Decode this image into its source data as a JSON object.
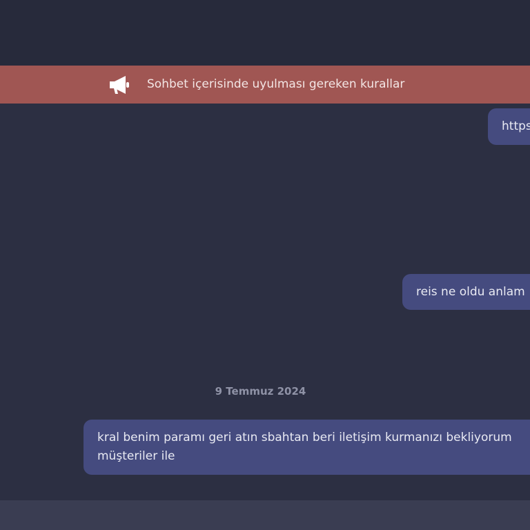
{
  "banner": {
    "icon": "megaphone-icon",
    "text": "Sohbet içerisinde uyulması gereken kurallar",
    "color": "#a05653"
  },
  "messages": [
    {
      "text": "https"
    },
    {
      "text": "reis ne oldu anlam"
    },
    {
      "text": "kral benim paramı geri atın sbahtan beri iletişim kurmanızı bekliyorum\nmüşteriler ile"
    }
  ],
  "date_separator": "9 Temmuz 2024",
  "colors": {
    "background": "#2c2f42",
    "header": "#272a3b",
    "bubble": "#454b7f",
    "footer": "#3a3d52"
  }
}
